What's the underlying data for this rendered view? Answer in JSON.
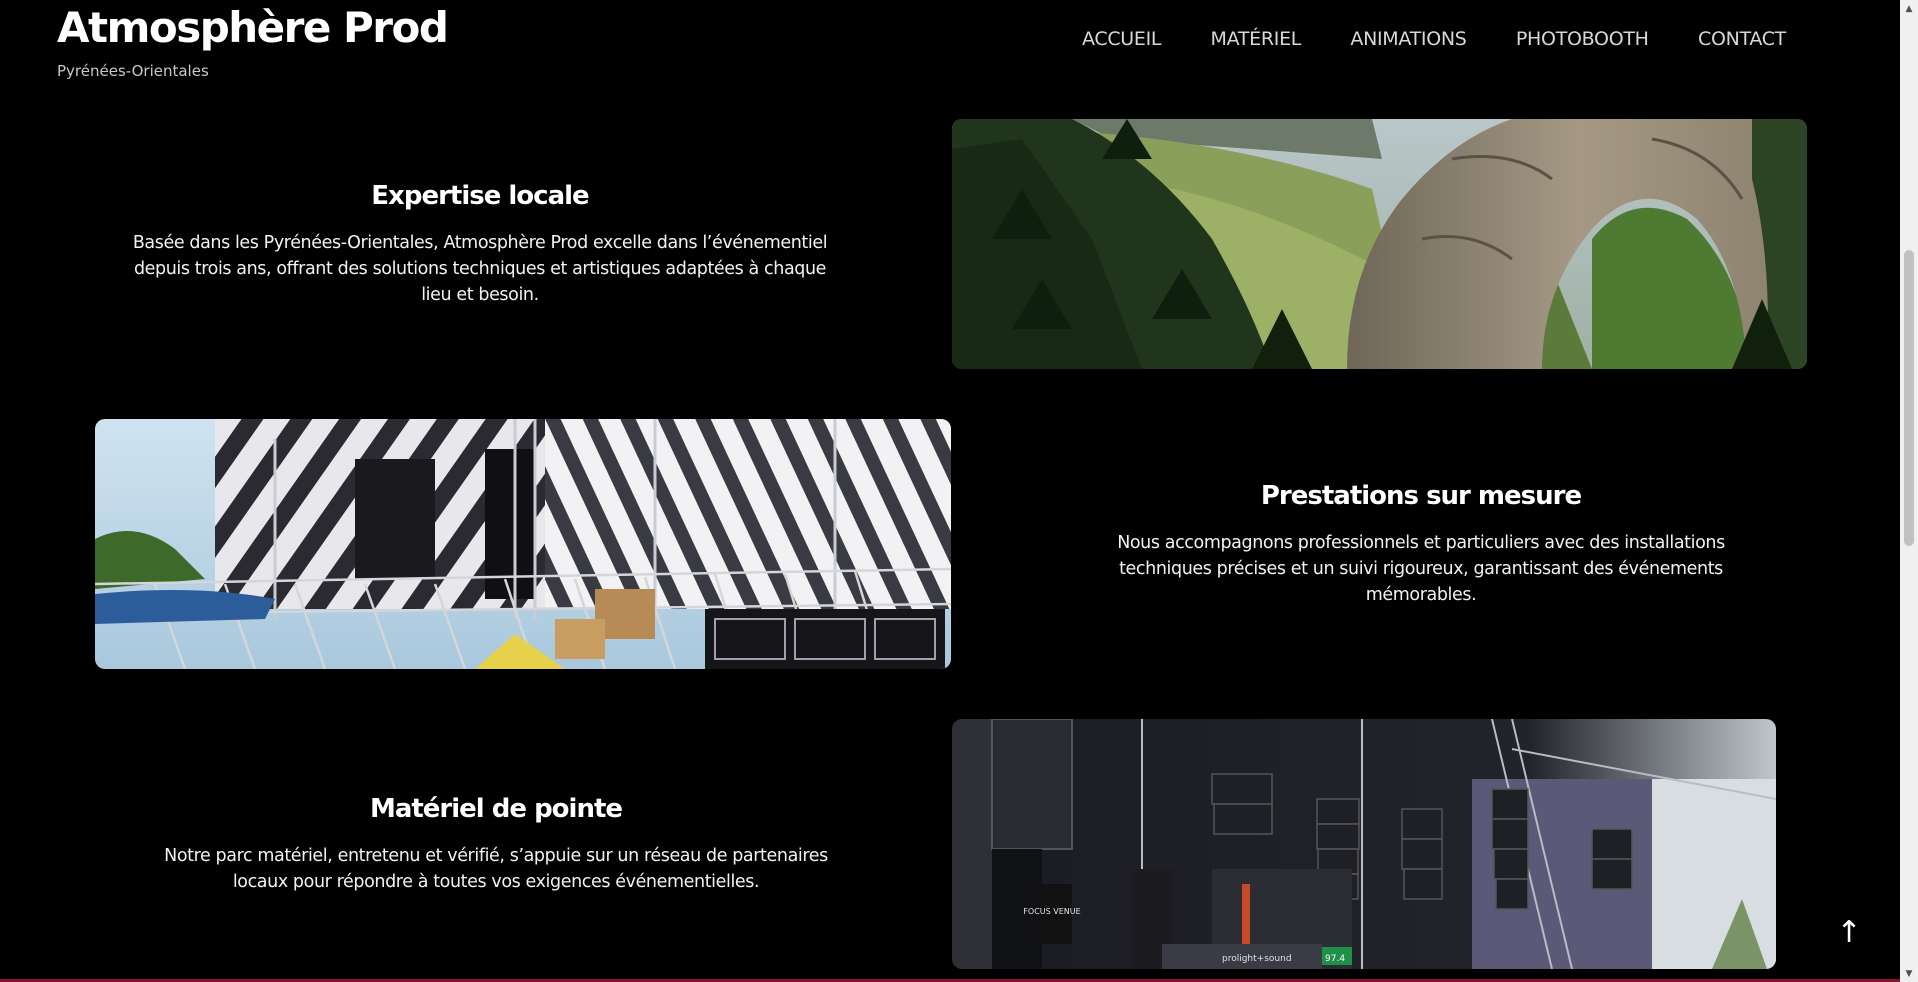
{
  "brand": {
    "title": "Atmosphère Prod",
    "subtitle": "Pyrénées-Orientales"
  },
  "nav": [
    {
      "label": "ACCUEIL"
    },
    {
      "label": "MATÉRIEL"
    },
    {
      "label": "ANIMATIONS"
    },
    {
      "label": "PHOTOBOOTH"
    },
    {
      "label": "CONTACT"
    }
  ],
  "sections": [
    {
      "title": "Expertise locale",
      "text": "Basée dans les Pyrénées-Orientales, Atmosphère Prod excelle dans l’événementiel depuis trois ans, offrant des solutions techniques et artistiques adaptées à chaque lieu et besoin.",
      "image_icon": "mountain-arch-photo"
    },
    {
      "title": "Prestations sur mesure",
      "text": "Nous accompagnons professionnels et particuliers avec des installations techniques précises et un suivi rigoureux, garantissant des événements mémorables.",
      "image_icon": "stage-construction-photo"
    },
    {
      "title": "Matériel de pointe",
      "text": "Notre parc matériel, entretenu et vérifié, s’appuie sur un réseau de partenaires locaux pour répondre à toutes vos exigences événementielles.",
      "image_icon": "line-array-speakers-photo",
      "photo_signs": [
        "FOCUS VENUE",
        "prolight+sound",
        "97.4"
      ]
    }
  ],
  "scroll_top": {
    "icon": "arrow-up-icon",
    "glyph": "↑"
  },
  "scrollbar": {
    "up_glyph": "▲",
    "down_glyph": "▼"
  },
  "colors": {
    "background": "#000000",
    "accent_line": "#8a1030",
    "nav_text": "#d8d8d8"
  }
}
